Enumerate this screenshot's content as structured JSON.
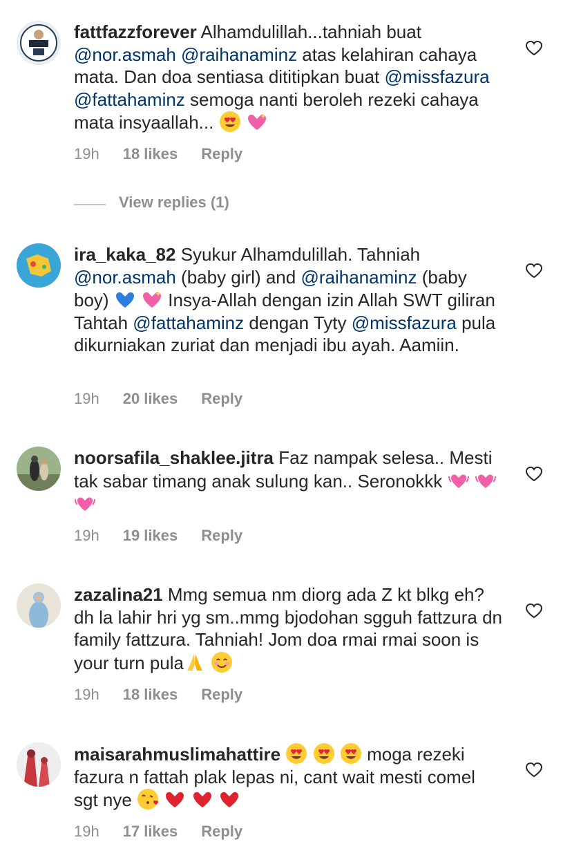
{
  "comments": [
    {
      "username": "fattfazzforever",
      "parts": [
        "Alhamdulillah...tahniah buat ",
        "@nor.asmah",
        " ",
        "@raihanaminz",
        " atas kelahiran cahaya mata. Dan doa sentiasa dititipkan buat ",
        "@missfazura",
        " ",
        "@fattahaminz",
        " semoga nanti beroleh rezeki cahaya mata insyaallah..."
      ],
      "time": "19h",
      "likes": "18 likes",
      "reply": "Reply",
      "emojis": [
        "heart-eyes",
        "sparkling-heart"
      ]
    },
    {
      "username": "ira_kaka_82",
      "parts": [
        "Syukur Alhamdulillah. Tahniah ",
        "@nor.asmah",
        " (baby girl) and ",
        "@raihanaminz",
        " (baby boy) ",
        "Insya-Allah dengan izin Allah SWT giliran Tahtah ",
        "@fattahaminz",
        " dengan Tyty ",
        "@missfazura",
        " pula dikurniakan zuriat dan menjadi ibu ayah. Aamiin."
      ],
      "time": "19h",
      "likes": "20 likes",
      "reply": "Reply",
      "emojis": [
        "blue-heart",
        "sparkling-heart"
      ]
    },
    {
      "username": "noorsafila_shaklee.jitra",
      "parts": [
        "Faz nampak selesa.. Mesti tak sabar timang anak sulung kan.. Seronokkk"
      ],
      "time": "19h",
      "likes": "19 likes",
      "reply": "Reply",
      "emojis": [
        "beating-heart",
        "beating-heart",
        "beating-heart"
      ]
    },
    {
      "username": "zazalina21",
      "parts": [
        "Mmg semua nm diorg ada Z kt blkg eh?dh la lahir hri yg sm..mmg bjodohan sgguh fattzura dn family fattzura. Tahniah! Jom doa rmai rmai soon is your turn pula"
      ],
      "time": "19h",
      "likes": "18 likes",
      "reply": "Reply",
      "emojis": [
        "folded-hands",
        "smiling-face"
      ]
    },
    {
      "username": "maisarahmuslimahattire",
      "parts": [
        "moga rezeki fazura n fattah plak lepas ni,  cant wait mesti comel sgt nye"
      ],
      "time": "19h",
      "likes": "17 likes",
      "reply": "Reply",
      "emojis": [
        "heart-eyes",
        "heart-eyes",
        "heart-eyes",
        "kissing-face",
        "red-heart",
        "red-heart",
        "red-heart"
      ]
    }
  ],
  "view_replies": "View replies (1)",
  "colors": {
    "text": "#262626",
    "mention": "#003569",
    "meta": "#8e8e8e"
  },
  "icons": {
    "like": "heart-outline-icon"
  }
}
